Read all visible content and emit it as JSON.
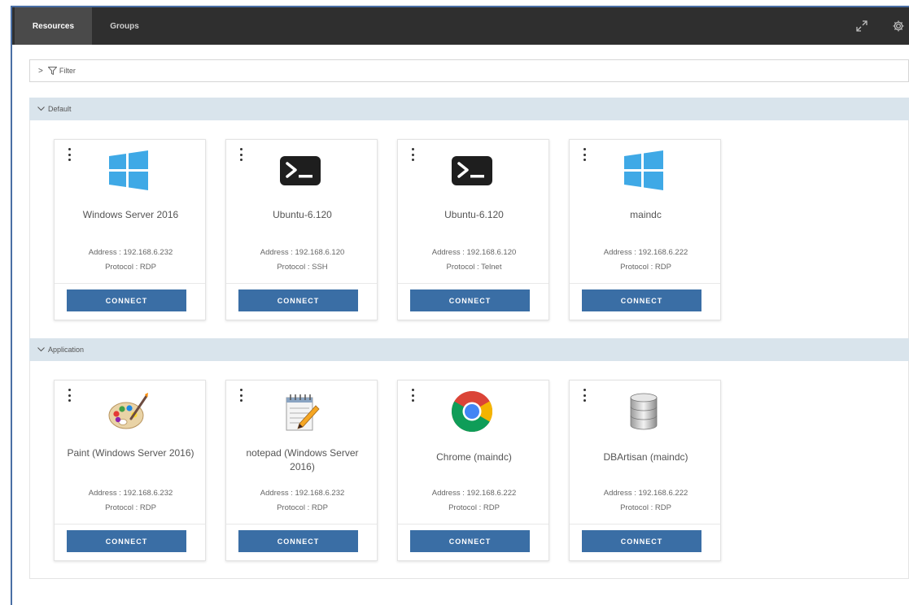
{
  "tabs": [
    {
      "label": "Resources",
      "active": true
    },
    {
      "label": "Groups",
      "active": false
    }
  ],
  "filter": {
    "label": "Filter"
  },
  "sections": [
    {
      "title": "Default",
      "cards": [
        {
          "name": "Windows Server 2016",
          "address": "Address : 192.168.6.232",
          "protocol": "Protocol : RDP",
          "icon": "windows-icon",
          "button": "CONNECT"
        },
        {
          "name": "Ubuntu-6.120",
          "address": "Address : 192.168.6.120",
          "protocol": "Protocol : SSH",
          "icon": "terminal-icon",
          "button": "CONNECT"
        },
        {
          "name": "Ubuntu-6.120",
          "address": "Address : 192.168.6.120",
          "protocol": "Protocol : Telnet",
          "icon": "terminal-icon",
          "button": "CONNECT"
        },
        {
          "name": "maindc",
          "address": "Address : 192.168.6.222",
          "protocol": "Protocol : RDP",
          "icon": "windows-icon",
          "button": "CONNECT"
        }
      ]
    },
    {
      "title": "Application",
      "cards": [
        {
          "name": "Paint (Windows Server 2016)",
          "address": "Address : 192.168.6.232",
          "protocol": "Protocol : RDP",
          "icon": "paint-icon",
          "button": "CONNECT"
        },
        {
          "name": "notepad (Windows Server 2016)",
          "address": "Address : 192.168.6.232",
          "protocol": "Protocol : RDP",
          "icon": "notepad-icon",
          "button": "CONNECT"
        },
        {
          "name": "Chrome (maindc)",
          "address": "Address : 192.168.6.222",
          "protocol": "Protocol : RDP",
          "icon": "chrome-icon",
          "button": "CONNECT"
        },
        {
          "name": "DBArtisan (maindc)",
          "address": "Address : 192.168.6.222",
          "protocol": "Protocol : RDP",
          "icon": "database-icon",
          "button": "CONNECT"
        }
      ]
    }
  ],
  "colors": {
    "topbar": "#2f2f2f",
    "section_header": "#d9e4ec",
    "connect_button": "#3a6ea5",
    "windows_blue": "#3fa9e6"
  }
}
